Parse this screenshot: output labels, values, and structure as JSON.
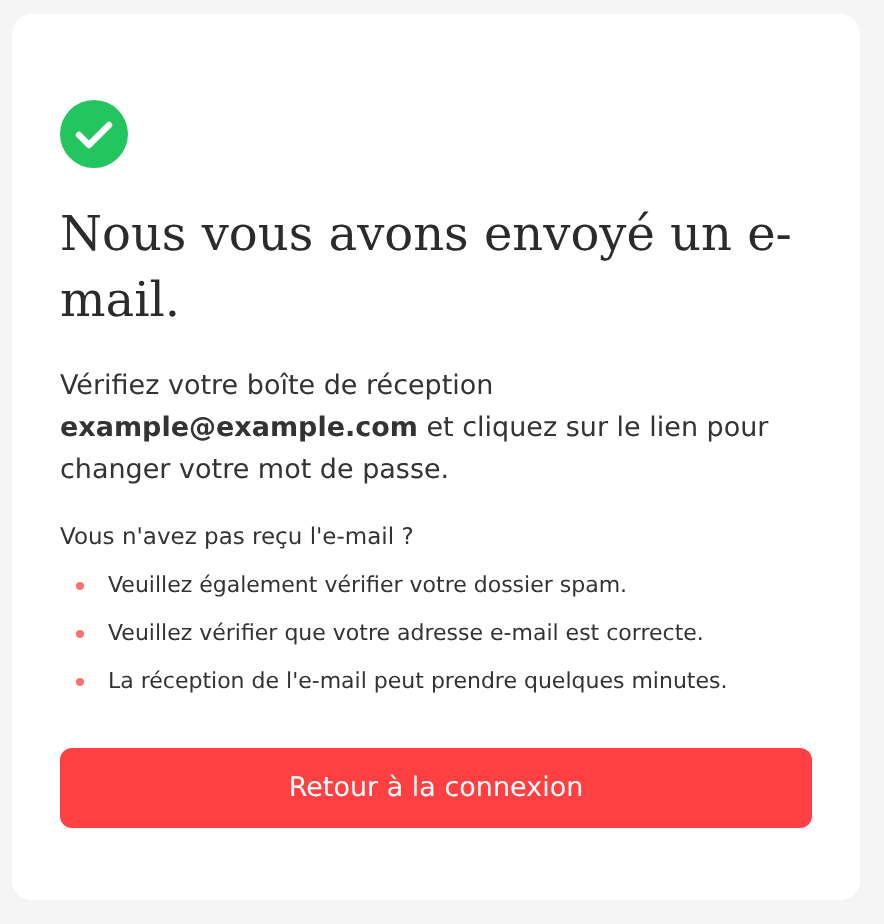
{
  "card": {
    "title": "Nous vous avons envoyé un e-mail.",
    "message": "Vérifiez votre boîte de réception **example@example.com** et cliquez sur le lien pour changer votre mot de passe.",
    "hint_title": "Vous n'avez pas reçu l'e-mail ?",
    "tips": [
      "Veuillez également vérifier votre dossier spam.",
      "Veuillez vérifier que votre adresse e-mail est correcte.",
      "La réception de l'e-mail peut prendre quelques minutes."
    ],
    "button": "Retour à la connexion"
  }
}
